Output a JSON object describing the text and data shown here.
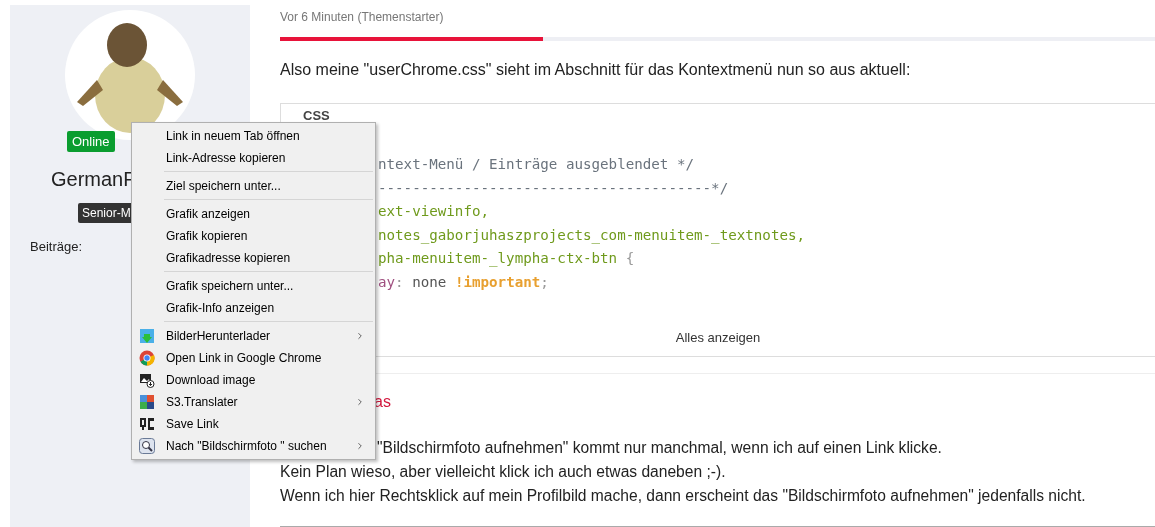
{
  "profile": {
    "status": "Online",
    "name": "GermanF",
    "rank": "Senior-M",
    "posts_label": "Beiträge:"
  },
  "post": {
    "time": "Vor 6 Minuten (Themenstarter)",
    "progress": {
      "level": 0.3
    },
    "intro": "Also meine \"userChrome.css\" sieht im Abschnitt für das Kontextmenü nun so aus aktuell:",
    "code": {
      "language": "CSS",
      "lines": [
        [
          {
            "kind": "comment",
            "text": "ntext-Menü / Einträge ausgeblendet */"
          }
        ],
        [
          {
            "kind": "comment",
            "text": "---------------------------------------*/"
          }
        ],
        [
          {
            "kind": "selector",
            "text": "ext-viewinfo,"
          }
        ],
        [
          {
            "kind": "selector",
            "text": "notes_gaborjuhaszprojects_com-menuitem-_textnotes,"
          }
        ],
        [
          {
            "kind": "selector",
            "text": "pha-menuitem-_lympha-ctx-btn"
          },
          {
            "kind": "punct",
            "text": " {"
          }
        ],
        [
          {
            "kind": "property",
            "text": "ay"
          },
          {
            "kind": "punct",
            "text": ": "
          },
          {
            "kind": "value",
            "text": "none "
          },
          {
            "kind": "important",
            "text": "!important"
          },
          {
            "kind": "punct",
            "text": ";"
          }
        ]
      ],
      "show_all": "Alles anzeigen"
    }
  },
  "reply": {
    "author": "as",
    "lines": [
      "\"Bildschirmfoto aufnehmen\" kommt nur manchmal, wenn ich auf einen Link klicke.",
      "Kein Plan wieso, aber vielleicht klick ich auch etwas daneben ;-).",
      "Wenn ich hier Rechtsklick auf mein Profilbild mache, dann erscheint das \"Bildschirmfoto aufnehmen\" jedenfalls nicht."
    ]
  },
  "context_menu": {
    "groups": [
      [
        {
          "label": "Link in neuem Tab öffnen",
          "submenu": false
        },
        {
          "label": "Link-Adresse kopieren",
          "submenu": false
        }
      ],
      [
        {
          "label": "Ziel speichern unter...",
          "submenu": false
        }
      ],
      [
        {
          "label": "Grafik anzeigen",
          "submenu": false
        },
        {
          "label": "Grafik kopieren",
          "submenu": false
        },
        {
          "label": "Grafikadresse kopieren",
          "submenu": false
        }
      ],
      [
        {
          "label": "Grafik speichern unter...",
          "submenu": false
        },
        {
          "label": "Grafik-Info anzeigen",
          "submenu": false
        }
      ],
      [
        {
          "label": "BilderHerunterlader",
          "submenu": true
        },
        {
          "label": "Open Link in Google Chrome",
          "submenu": false
        },
        {
          "label": "Download image",
          "submenu": false
        },
        {
          "label": "S3.Translater",
          "submenu": true
        },
        {
          "label": "Save Link",
          "submenu": false
        },
        {
          "label": "Nach \"Bildschirmfoto \" suchen",
          "submenu": true
        }
      ]
    ]
  }
}
